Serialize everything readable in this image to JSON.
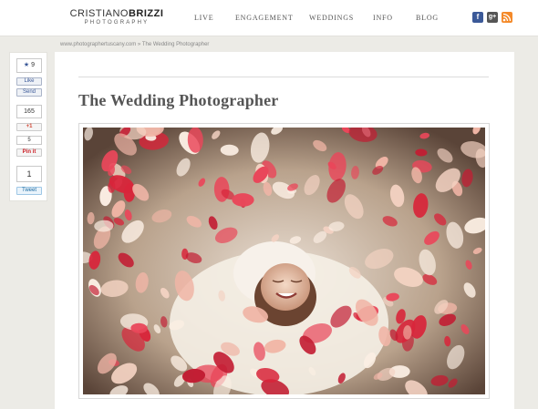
{
  "logo": {
    "first": "CRISTIANO",
    "second": "BRIZZI",
    "sub": "PHOTOGRAPHY"
  },
  "nav": [
    "LIVE",
    "ENGAGEMENT",
    "WEDDINGS",
    "INFO",
    "BLOG"
  ],
  "social": {
    "facebook": {
      "icon": "facebook-icon",
      "glyph": "f",
      "color": "#3b5998"
    },
    "google": {
      "icon": "google-plus-icon",
      "glyph": "g+",
      "color": "#555555"
    },
    "rss": {
      "icon": "rss-icon",
      "glyph": "◠",
      "color": "#f48a2a"
    }
  },
  "breadcrumb": "www.photographertuscany.com » The Wedding Photographer",
  "share": {
    "like_count": "9",
    "like_label": "Like",
    "send_label": "Send",
    "plusone_count": "165",
    "plusone_label": "+1",
    "pin_count": "5",
    "pin_label": "Pin it",
    "tweet_count": "1",
    "tweet_label": "Tweet"
  },
  "page_title": "The Wedding Photographer",
  "photo": {
    "icon": "bride-among-petals-photo"
  }
}
